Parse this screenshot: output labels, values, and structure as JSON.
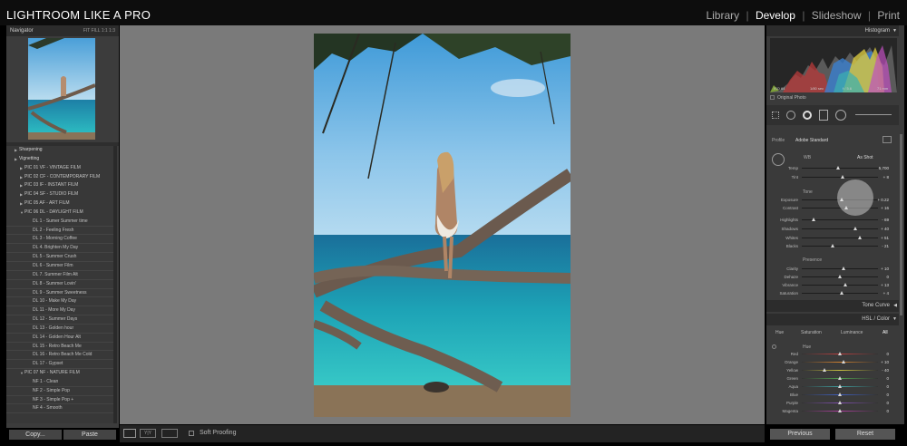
{
  "app_title": "LIGHTROOM LIKE A PRO",
  "modules": {
    "library": "Library",
    "develop": "Develop",
    "slideshow": "Slideshow",
    "print": "Print",
    "separator": "|"
  },
  "navigator": {
    "title": "Navigator",
    "zoom": "FIT  FILL  1:1  1:3"
  },
  "presets": [
    {
      "label": "Sharpening",
      "level": 1
    },
    {
      "label": "Vignetting",
      "level": 1
    },
    {
      "label": "PIC 01 VF  - VINTAGE FILM",
      "level": 2
    },
    {
      "label": "PIC 02 CF  - CONTEMPORARY FILM",
      "level": 2
    },
    {
      "label": "PIC 03 IF  - INSTANT FILM",
      "level": 2
    },
    {
      "label": "PIC 04 SF  - STUDIO FILM",
      "level": 2
    },
    {
      "label": "PIC 05 AF  - ART FILM",
      "level": 2
    },
    {
      "label": "PIC 06 DL  - DAYLIGHT FILM",
      "level": 2,
      "open": true
    },
    {
      "label": "DL 1 - Sumer Summer time",
      "level": 3
    },
    {
      "label": "DL 2 - Feeling Fresh",
      "level": 3
    },
    {
      "label": "DL 3 - Morning Coffee",
      "level": 3
    },
    {
      "label": "DL 4. Brighten My Day",
      "level": 3
    },
    {
      "label": "DL 5 - Summer Crush",
      "level": 3
    },
    {
      "label": "DL 6 - Summer Film",
      "level": 3
    },
    {
      "label": "DL 7. Summer Film Alt",
      "level": 3
    },
    {
      "label": "DL 8 - Summer Lovin'",
      "level": 3
    },
    {
      "label": "DL 9 - Summer Sweetness",
      "level": 3
    },
    {
      "label": "DL 10 - Make My Day",
      "level": 3
    },
    {
      "label": "DL 11 - More My Day",
      "level": 3
    },
    {
      "label": "DL 12 - Summer Days",
      "level": 3
    },
    {
      "label": "DL 13 - Golden hour",
      "level": 3
    },
    {
      "label": "DL 14 - Golden Hour Alt",
      "level": 3
    },
    {
      "label": "DL 15 - Retro Beach Me",
      "level": 3
    },
    {
      "label": "DL 16 - Retro Beach Me Cold",
      "level": 3
    },
    {
      "label": "DL 17 - Gypset",
      "level": 3
    },
    {
      "label": "PIC 07 NF  - NATURE FILM",
      "level": 2,
      "open": true
    },
    {
      "label": "NF 1 - Clean",
      "level": 3
    },
    {
      "label": "NF 2 - Simple Pop",
      "level": 3
    },
    {
      "label": "NF 3 - Simple Pop +",
      "level": 3
    },
    {
      "label": "NF 4 - Smooth",
      "level": 3
    }
  ],
  "buttons": {
    "copy": "Copy...",
    "paste": "Paste",
    "previous": "Previous",
    "reset": "Reset"
  },
  "toolbar": {
    "soft_proofing": "Soft Proofing"
  },
  "histogram": {
    "title": "Histogram",
    "iso": "ISO 64",
    "shutter": "1/80 sec",
    "aperture": "f / 5.6",
    "focal": "71 mm",
    "original_photo": "Original Photo"
  },
  "basic": {
    "profile_label": "Profile",
    "profile_value": "Adobe Standard",
    "wb_label": "WB",
    "wb_value": "As Shot",
    "tone_label": "Tone",
    "presence_label": "Presence",
    "sliders": [
      {
        "label": "Temp",
        "value": "5,700",
        "pos": 0.48
      },
      {
        "label": "Tint",
        "value": "+ 8",
        "pos": 0.53
      },
      {
        "label": "Exposure",
        "value": "+ 0.22",
        "pos": 0.52
      },
      {
        "label": "Contrast",
        "value": "+ 16",
        "pos": 0.58
      },
      {
        "label": "Highlights",
        "value": "- 69",
        "pos": 0.15
      },
      {
        "label": "Shadows",
        "value": "+ 40",
        "pos": 0.7
      },
      {
        "label": "Whites",
        "value": "+ 51",
        "pos": 0.76
      },
      {
        "label": "Blacks",
        "value": "- 21",
        "pos": 0.4
      },
      {
        "label": "Clarity",
        "value": "+ 10",
        "pos": 0.55
      },
      {
        "label": "Dehaze",
        "value": "0",
        "pos": 0.5
      },
      {
        "label": "Vibrance",
        "value": "+ 13",
        "pos": 0.57
      },
      {
        "label": "Saturation",
        "value": "+ 4",
        "pos": 0.52
      }
    ]
  },
  "tone_curve": {
    "title": "Tone Curve"
  },
  "hsl": {
    "title": "HSL / Color",
    "tabs": [
      "Hue",
      "Saturation",
      "Luminance",
      "All"
    ],
    "hue_label": "Hue",
    "sliders": [
      {
        "label": "Red",
        "value": "0",
        "pos": 0.5,
        "color": "#c04040"
      },
      {
        "label": "Orange",
        "value": "+ 10",
        "pos": 0.55,
        "color": "#d08030"
      },
      {
        "label": "Yellow",
        "value": "- 40",
        "pos": 0.3,
        "color": "#c8c040"
      },
      {
        "label": "Green",
        "value": "0",
        "pos": 0.5,
        "color": "#50a050"
      },
      {
        "label": "Aqua",
        "value": "0",
        "pos": 0.5,
        "color": "#40a0a0"
      },
      {
        "label": "Blue",
        "value": "0",
        "pos": 0.5,
        "color": "#4060c0"
      },
      {
        "label": "Purple",
        "value": "0",
        "pos": 0.5,
        "color": "#8050b0"
      },
      {
        "label": "Magenta",
        "value": "0",
        "pos": 0.5,
        "color": "#b040a0"
      }
    ]
  }
}
